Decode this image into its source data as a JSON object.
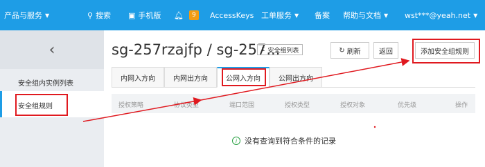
{
  "topbar": {
    "products": "产品与服务",
    "search": "搜索",
    "mobile": "手机版",
    "notifications_count": "9",
    "accesskeys": "AccessKeys",
    "tickets": "工单服务",
    "beian": "备案",
    "help": "帮助与文档",
    "user": "wst***@yeah.net"
  },
  "sidebar": {
    "back_glyph": "‹",
    "items": [
      {
        "label": "安全组内实例列表"
      },
      {
        "label": "安全组规则"
      }
    ]
  },
  "header": {
    "title": "sg-257rzajfp / sg-257...",
    "list_link": "安全组列表",
    "refresh": "刷新",
    "back": "返回",
    "add_rule": "添加安全组规则"
  },
  "tabs": [
    {
      "label": "内网入方向"
    },
    {
      "label": "内网出方向"
    },
    {
      "label": "公网入方向"
    },
    {
      "label": "公网出方向"
    }
  ],
  "table": {
    "columns": [
      "授权策略",
      "协议类型",
      "端口范围",
      "授权类型",
      "授权对象",
      "优先级",
      "操作"
    ]
  },
  "empty_message": "没有查询到符合条件的记录",
  "colors": {
    "topbar": "#1e9de6",
    "annotation": "#e0191f",
    "badge": "#f39c12"
  }
}
